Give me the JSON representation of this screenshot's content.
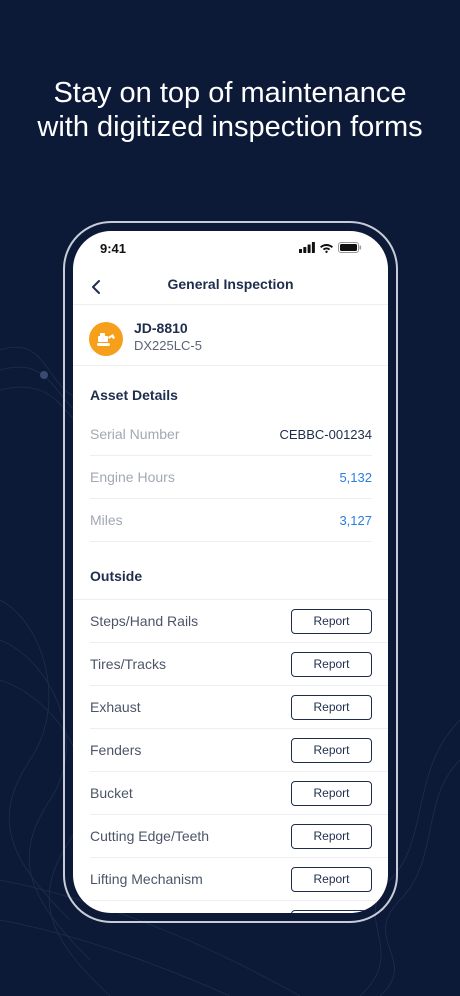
{
  "headline": {
    "line1": "Stay on top of maintenance",
    "line2": "with digitized inspection forms"
  },
  "status_bar": {
    "time": "9:41",
    "icons": [
      "signal-icon",
      "wifi-icon",
      "battery-icon"
    ]
  },
  "nav": {
    "title": "General Inspection",
    "back_icon": "chevron-left-icon"
  },
  "asset": {
    "id": "JD-8810",
    "model": "DX225LC-5",
    "icon": "excavator-icon",
    "icon_bg": "#f59f1b"
  },
  "asset_details": {
    "title": "Asset Details",
    "rows": [
      {
        "label": "Serial Number",
        "value": "CEBBC-001234"
      },
      {
        "label": "Engine Hours",
        "value": "5,132"
      },
      {
        "label": "Miles",
        "value": "3,127"
      }
    ]
  },
  "outside": {
    "title": "Outside",
    "items": [
      {
        "label": "Steps/Hand Rails",
        "button": "Report"
      },
      {
        "label": "Tires/Tracks",
        "button": "Report"
      },
      {
        "label": "Exhaust",
        "button": "Report"
      },
      {
        "label": "Fenders",
        "button": "Report"
      },
      {
        "label": "Bucket",
        "button": "Report"
      },
      {
        "label": "Cutting Edge/Teeth",
        "button": "Report"
      },
      {
        "label": "Lifting Mechanism",
        "button": "Report"
      }
    ]
  },
  "colors": {
    "background": "#0c1a38",
    "accent": "#f59f1b",
    "link": "#2b7de0",
    "text_dark": "#1f2d4d"
  }
}
